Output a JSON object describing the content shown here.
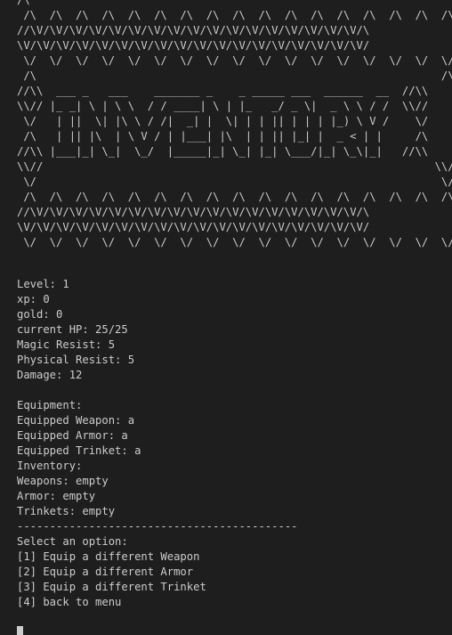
{
  "banner": {
    "lines": [
      "/\\",
      " /\\  /\\  /\\  /\\  /\\  /\\  /\\  /\\  /\\  /\\  /\\  /\\  /\\  /\\  /\\  /\\  /\\",
      "//\\V/\\V/\\V/\\V/\\V/\\V/\\V/\\V/\\V/\\V/\\V/\\V/\\V/\\V/\\V/\\V/\\V/\\",
      "\\V/\\V/\\V/\\V/\\V/\\V/\\V/\\V/\\V/\\V/\\V/\\V/\\V/\\V/\\V/\\V/\\V/\\V/",
      " \\/  \\/  \\/  \\/  \\/  \\/  \\/  \\/  \\/  \\/  \\/  \\/  \\/  \\/  \\/  \\/  \\/",
      " /\\                                                              /\\",
      "//\\\\  ___ _   ___    _______ _    _ _____ ___  ______  __  //\\\\",
      "\\\\// |_ _| \\ | \\ \\  / / ____| \\ | |_   _/ _ \\|  _ \\ \\ / /  \\\\//",
      " \\/   | ||  \\| |\\ \\ / /|  _| |  \\| | | || | | | |_) \\ V /    \\/",
      " /\\   | || |\\  | \\ V / | |___| |\\  | | || |_| |  _ < | |     /\\",
      "//\\\\ |___|_| \\_|  \\_/  |_____|_| \\_| |_| \\___/|_| \\_\\|_|   //\\\\",
      "\\\\//                                                            \\\\//",
      " \\/                                                              \\/",
      " /\\  /\\  /\\  /\\  /\\  /\\  /\\  /\\  /\\  /\\  /\\  /\\  /\\  /\\  /\\  /\\  /\\",
      "//\\V/\\V/\\V/\\V/\\V/\\V/\\V/\\V/\\V/\\V/\\V/\\V/\\V/\\V/\\V/\\V/\\V/\\",
      "\\V/\\V/\\V/\\V/\\V/\\V/\\V/\\V/\\V/\\V/\\V/\\V/\\V/\\V/\\V/\\V/\\V/\\V/",
      " \\/  \\/  \\/  \\/  \\/  \\/  \\/  \\/  \\/  \\/  \\/  \\/  \\/  \\/  \\/  \\/  \\/"
    ]
  },
  "stats": {
    "level": "Level: 1",
    "xp": "xp: 0",
    "gold": "gold: 0",
    "current_hp": "current HP: 25/25",
    "magic_resist": "Magic Resist: 5",
    "physical_resist": "Physical Resist: 5",
    "damage": "Damage: 12"
  },
  "equipment": {
    "header": "Equipment:",
    "weapon": "Equipped Weapon: a",
    "armor": "Equipped Armor: a",
    "trinket": "Equipped Trinket: a"
  },
  "inventory": {
    "header": "Inventory:",
    "weapons": "Weapons: empty",
    "armor": "Armor: empty",
    "trinkets": "Trinkets: empty"
  },
  "divider": "-------------------------------------------",
  "menu": {
    "prompt": "Select an option:",
    "options": [
      "[1] Equip a different Weapon",
      "[2] Equip a different Armor",
      "[3] Equip a different Trinket",
      "[4] back to menu"
    ]
  },
  "colors": {
    "background": "#1e1e1e",
    "foreground": "#cccccc"
  }
}
